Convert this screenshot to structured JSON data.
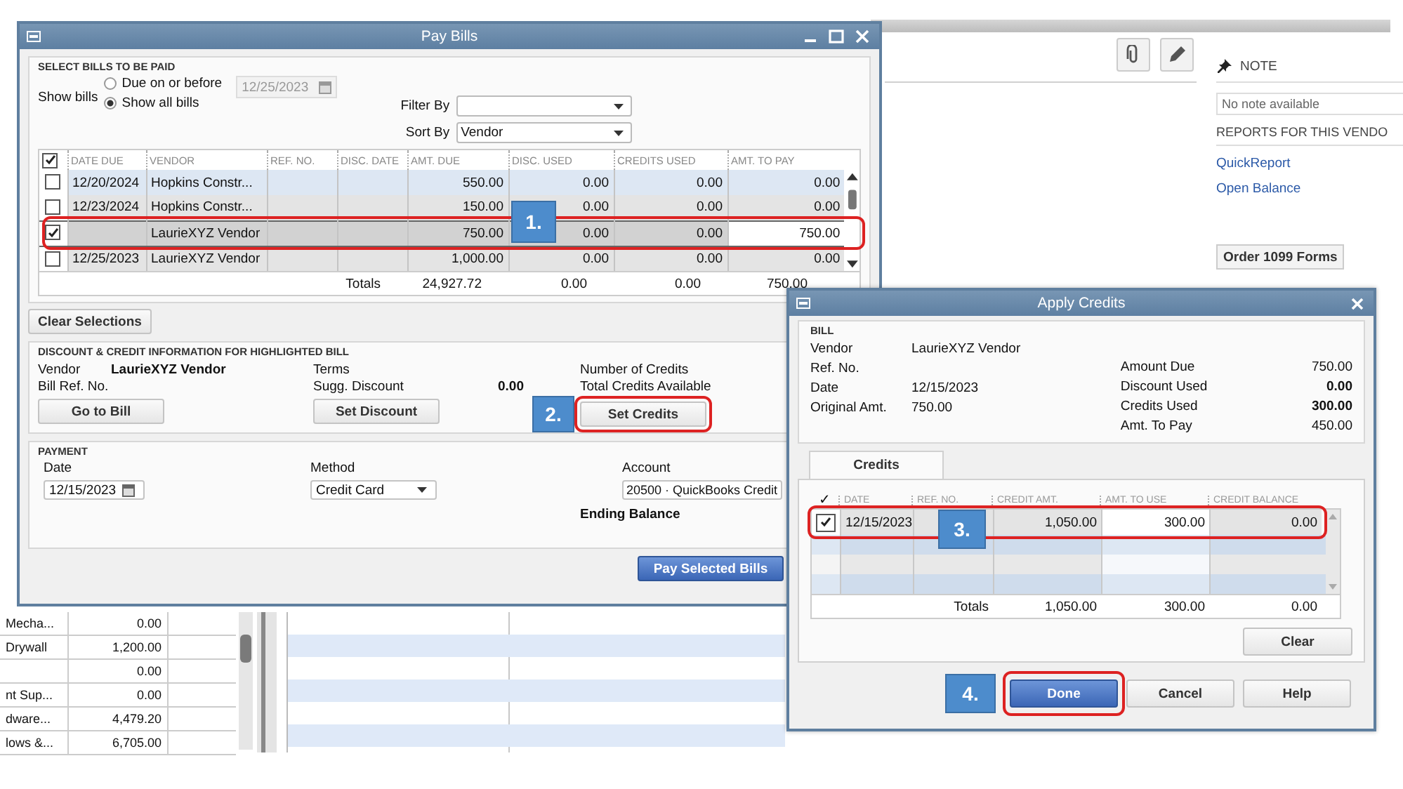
{
  "note": {
    "heading": "NOTE",
    "placeholder": "No note available"
  },
  "reports": {
    "heading": "REPORTS FOR THIS VENDO",
    "links": [
      "QuickReport",
      "Open Balance"
    ]
  },
  "order_button": "Order 1099 Forms",
  "vendor_list": [
    {
      "name": "Mecha...",
      "balance": "0.00"
    },
    {
      "name": "Drywall",
      "balance": "1,200.00"
    },
    {
      "balance": "0.00"
    },
    {
      "name": "nt Sup...",
      "balance": "0.00"
    },
    {
      "name": "dware...",
      "balance": "4,479.20"
    },
    {
      "name": "lows &...",
      "balance": "6,705.00"
    }
  ],
  "pay_bills": {
    "title": "Pay Bills",
    "select_section": "SELECT BILLS TO BE PAID",
    "show_bills_label": "Show bills",
    "show_options": [
      {
        "label": "Due on or before",
        "selected": false
      },
      {
        "label": "Show all bills",
        "selected": true
      }
    ],
    "due_date": {
      "value": "12/25/2023",
      "disabled": true
    },
    "filter_by": {
      "label": "Filter By"
    },
    "sort_by": {
      "label": "Sort By",
      "value": "Vendor"
    },
    "all_checked": true,
    "columns": [
      "DATE DUE",
      "VENDOR",
      "REF. NO.",
      "DISC. DATE",
      "AMT. DUE",
      "DISC. USED",
      "CREDITS USED",
      "AMT. TO PAY"
    ],
    "rows": [
      {
        "checked": false,
        "selected": false,
        "cells": [
          "12/20/2024",
          "Hopkins Constr...",
          "",
          "",
          "550.00",
          "0.00",
          "0.00",
          "0.00"
        ]
      },
      {
        "checked": false,
        "selected": false,
        "cells": [
          "12/23/2024",
          "Hopkins Constr...",
          "",
          "",
          "150.00",
          "0.00",
          "0.00",
          "0.00"
        ]
      },
      {
        "checked": true,
        "selected": true,
        "cells": [
          "",
          "LaurieXYZ Vendor",
          "",
          "",
          "750.00",
          "0.00",
          "0.00",
          "750.00"
        ]
      },
      {
        "checked": false,
        "selected": false,
        "cells": [
          "12/25/2023",
          "LaurieXYZ Vendor",
          "",
          "",
          "1,000.00",
          "0.00",
          "0.00",
          "0.00"
        ]
      }
    ],
    "totals": {
      "label": "Totals",
      "amt_due": "24,927.72",
      "disc_used": "0.00",
      "credits_used": "0.00",
      "amt_to_pay": "750.00"
    },
    "clear_button": "Clear Selections",
    "credit_section": "DISCOUNT & CREDIT INFORMATION FOR HIGHLIGHTED BILL",
    "vendor_label": "Vendor",
    "vendor": "LaurieXYZ Vendor",
    "bill_ref_label": "Bill Ref. No.",
    "terms_label": "Terms",
    "sugg_discount_label": "Sugg. Discount",
    "sugg_discount": "0.00",
    "number_of_credits_label": "Number of Credits",
    "total_credits_label": "Total Credits Available",
    "go_to_bill": "Go to Bill",
    "set_discount": "Set Discount",
    "set_credits": "Set Credits",
    "payment_section": "PAYMENT",
    "date_label": "Date",
    "date": "12/15/2023",
    "method_label": "Method",
    "method": "Credit Card",
    "account_label": "Account",
    "account": "20500 · QuickBooks Credit",
    "ending_balance_label": "Ending Balance",
    "pay_button": "Pay Selected Bills"
  },
  "apply_credits": {
    "title": "Apply Credits",
    "bill_section": "BILL",
    "left_fields": [
      {
        "label": "Vendor",
        "value": "LaurieXYZ Vendor"
      },
      {
        "label": "Ref. No."
      },
      {
        "label": "Date",
        "value": "12/15/2023"
      },
      {
        "label": "Original Amt.",
        "value": "750.00"
      }
    ],
    "right_fields": [
      {
        "label": "Amount Due",
        "value": "750.00",
        "bold": false
      },
      {
        "label": "Discount Used",
        "value": "0.00",
        "bold": true
      },
      {
        "label": "Credits Used",
        "value": "300.00",
        "bold": true
      },
      {
        "label": "Amt. To Pay",
        "value": "450.00",
        "bold": false
      }
    ],
    "tabs": [
      {
        "label": "Credits",
        "selected": true
      }
    ],
    "columns": [
      "✓",
      "DATE",
      "REF. NO.",
      "CREDIT AMT.",
      "AMT. TO USE",
      "CREDIT BALANCE"
    ],
    "rows": [
      {
        "checked": true,
        "cells": [
          "",
          "12/15/2023",
          "",
          "1,050.00",
          "300.00",
          "0.00"
        ]
      }
    ],
    "totals": {
      "label": "Totals",
      "credit_amt": "1,050.00",
      "amt_to_use": "300.00",
      "credit_balance": "0.00"
    },
    "clear_button": "Clear",
    "buttons": [
      {
        "label": "Done",
        "kind": "primary"
      },
      {
        "label": "Cancel",
        "kind": "normal"
      },
      {
        "label": "Help",
        "kind": "normal"
      }
    ]
  },
  "callouts": [
    "1.",
    "2.",
    "3.",
    "4."
  ]
}
